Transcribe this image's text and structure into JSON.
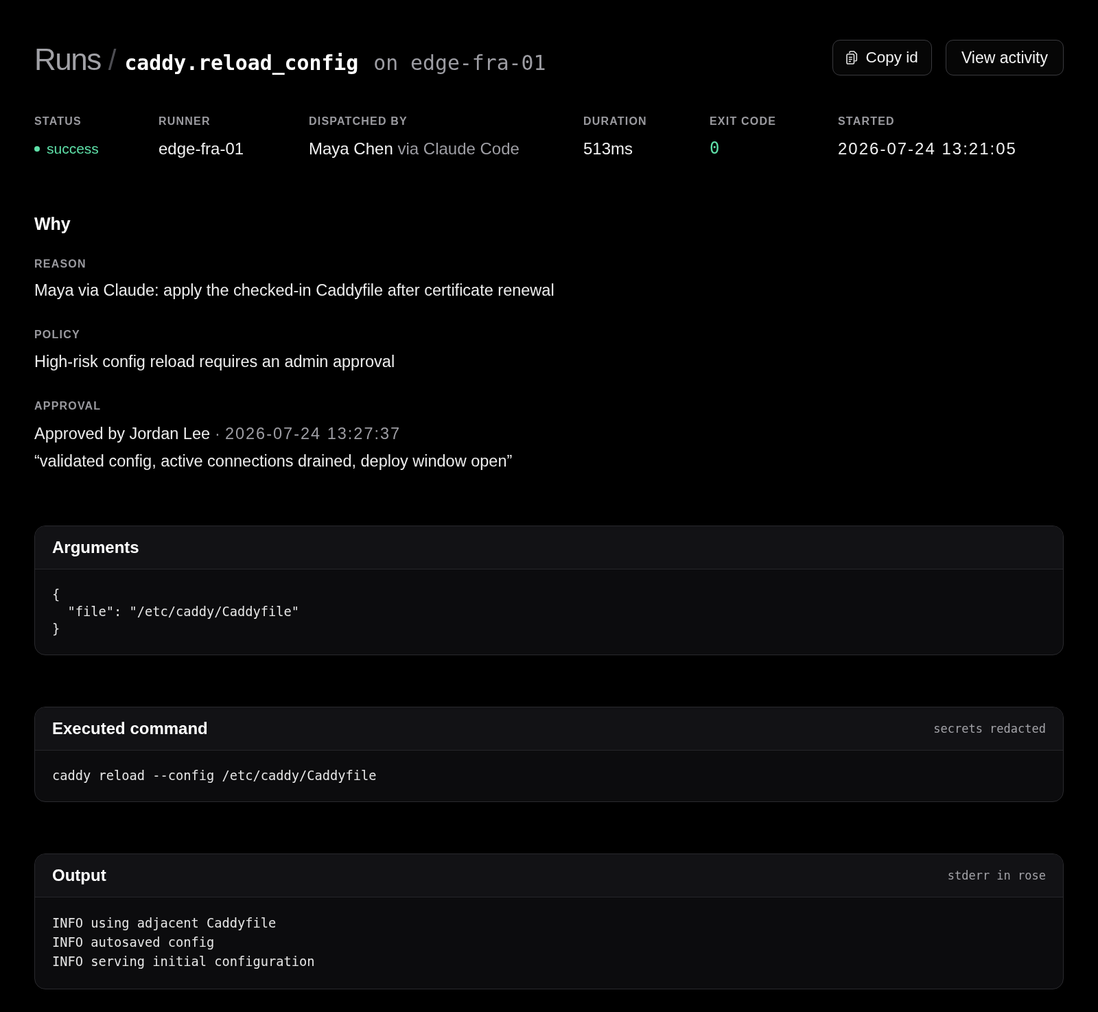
{
  "breadcrumb": {
    "root": "Runs",
    "separator": "/",
    "action": "caddy.reload_config",
    "host": "on edge-fra-01"
  },
  "actions": [
    {
      "kind": "copy",
      "label": "Copy id"
    },
    {
      "kind": "link",
      "label": "View activity"
    }
  ],
  "meta": [
    {
      "kind": "status",
      "label": "STATUS",
      "value": "success",
      "color": "#5ee0a8"
    },
    {
      "kind": "text",
      "label": "RUNNER",
      "value": "edge-fra-01"
    },
    {
      "kind": "dispatch",
      "label": "DISPATCHED BY",
      "value": "Maya Chen",
      "via": "via Claude Code"
    },
    {
      "kind": "text",
      "label": "DURATION",
      "value": "513ms"
    },
    {
      "kind": "code",
      "label": "EXIT CODE",
      "value": "0",
      "color": "#5ee0a8"
    },
    {
      "kind": "timestamp",
      "label": "STARTED",
      "value": "2026-07-24 13:21:05"
    }
  ],
  "why": {
    "heading": "Why",
    "fields": [
      {
        "kind": "text",
        "label": "REASON",
        "value": "Maya via Claude: apply the checked-in Caddyfile after certificate renewal"
      },
      {
        "kind": "text",
        "label": "POLICY",
        "value": "High-risk config reload requires an admin approval"
      },
      {
        "kind": "approval",
        "label": "APPROVAL",
        "value": "Approved by Jordan Lee",
        "separator": "·",
        "time": "2026-07-24 13:27:37",
        "comment": "“validated config, active connections drained, deploy window open”"
      }
    ]
  },
  "panels": [
    {
      "kind": "json",
      "title": "Arguments",
      "code": "{\n  \"file\": \"/etc/caddy/Caddyfile\"\n}"
    },
    {
      "kind": "command",
      "title": "Executed command",
      "note": "secrets redacted",
      "code": "caddy reload --config /etc/caddy/Caddyfile"
    },
    {
      "kind": "log",
      "title": "Output",
      "note": "stderr in rose",
      "lines": [
        "INFO using adjacent Caddyfile",
        "INFO autosaved config",
        "INFO serving initial configuration"
      ]
    }
  ]
}
